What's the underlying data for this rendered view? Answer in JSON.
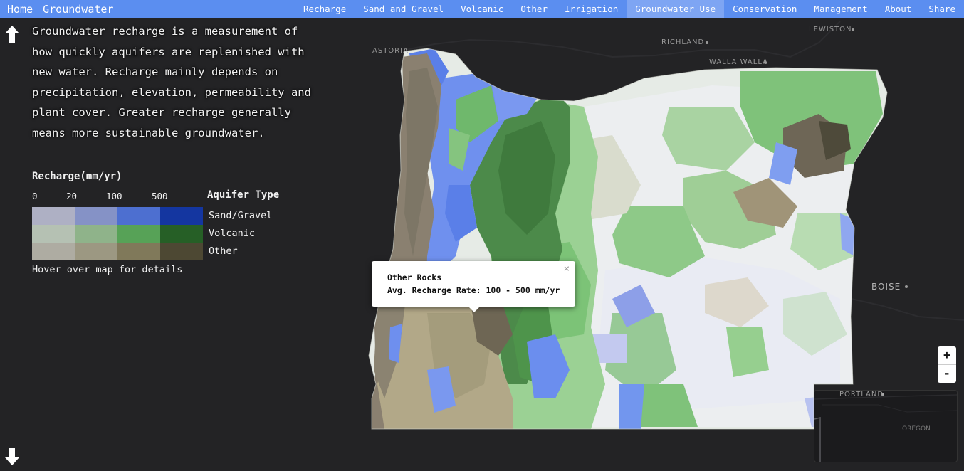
{
  "navbar": {
    "brand_home": "Home",
    "brand_title": "Groundwater",
    "links": [
      {
        "label": "Recharge"
      },
      {
        "label": "Sand and Gravel"
      },
      {
        "label": "Volcanic"
      },
      {
        "label": "Other"
      },
      {
        "label": "Irrigation"
      },
      {
        "label": "Groundwater Use",
        "active": true
      },
      {
        "label": "Conservation"
      },
      {
        "label": "Management"
      },
      {
        "label": "About"
      },
      {
        "label": "Share"
      }
    ]
  },
  "sidebar": {
    "intro": "Groundwater recharge is a measurement of how quickly aquifers are replenished with new water. Recharge mainly depends on precipitation, elevation, permeability and plant cover. Greater recharge generally means more sustainable groundwater.",
    "legend_title": "Recharge(mm/yr)",
    "ticks": [
      "0",
      "20",
      "100",
      "500"
    ],
    "aquifer_title": "Aquifer Type",
    "aquifer_types": [
      "Sand/Gravel",
      "Volcanic",
      "Other"
    ],
    "swatch_colors": [
      [
        "#aeb0c4",
        "#8592c6",
        "#4d6fd0",
        "#1436a0"
      ],
      [
        "#b5c1b3",
        "#8fb38a",
        "#57a257",
        "#265f26"
      ],
      [
        "#aeaca2",
        "#9c9882",
        "#80795a",
        "#4d4833"
      ]
    ],
    "hover_hint": "Hover over map for details"
  },
  "popup": {
    "title": "Other Rocks",
    "line": "Avg. Recharge Rate: 100 - 500 mm/yr",
    "close": "×"
  },
  "zoom": {
    "in": "+",
    "out": "-"
  },
  "places": {
    "astoria": "ASTORIA",
    "richland": "RICHLAND",
    "walla_walla": "WALLA WALLA",
    "lewiston": "LEWISTON",
    "boise": "BOISE",
    "portland": "PORTLAND",
    "oregon": "OREGON"
  },
  "colors": {
    "navbar": "#5b8ef0",
    "navbar_active": "#7ea5f3",
    "background": "#1d1d1f"
  }
}
